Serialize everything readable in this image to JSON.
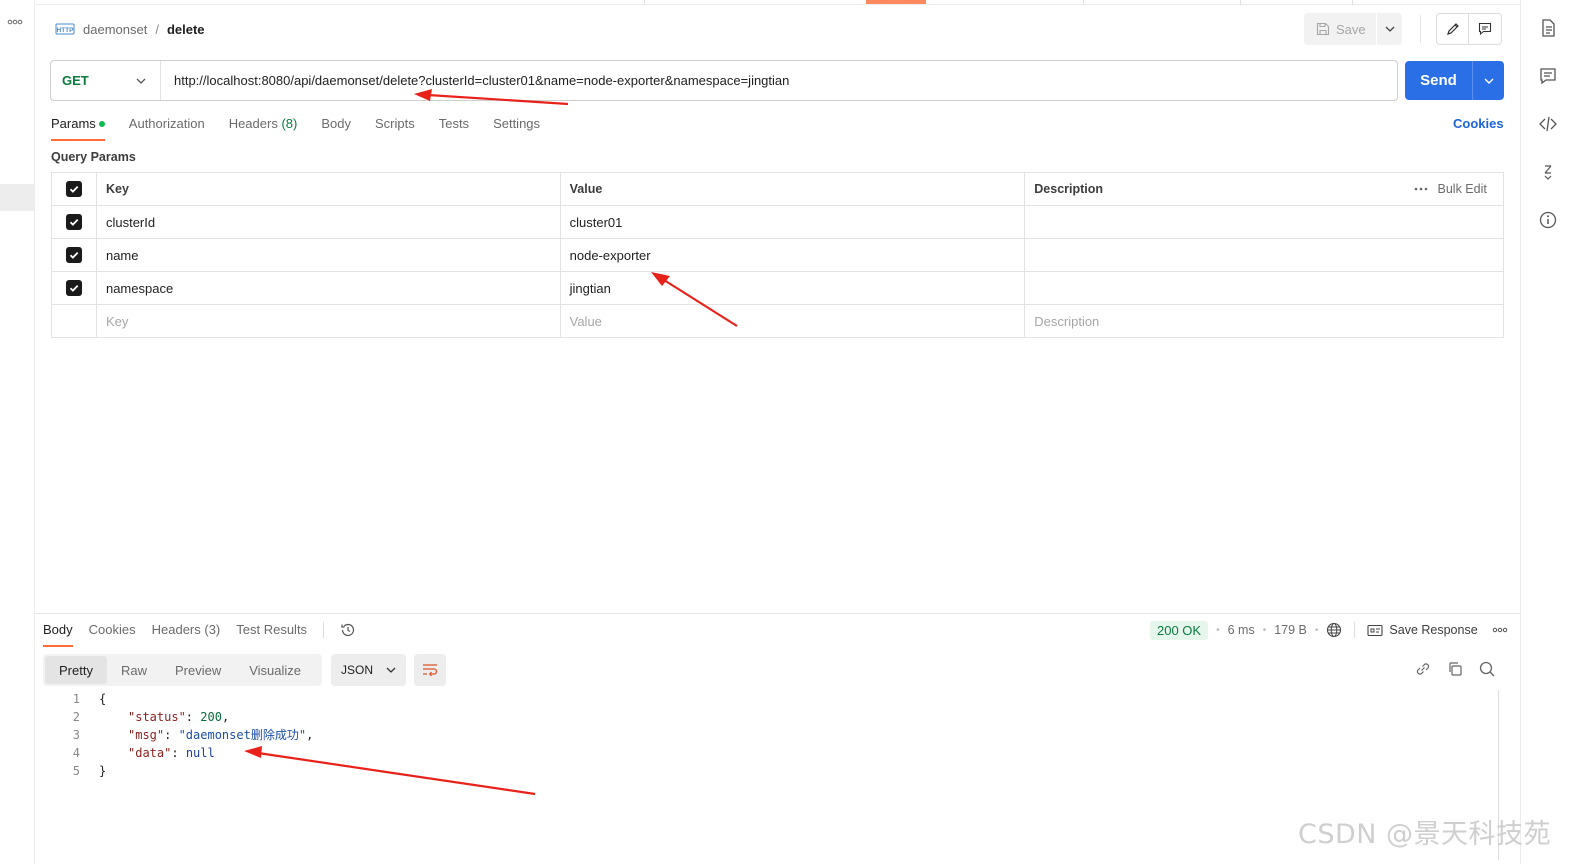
{
  "header": {
    "breadcrumb_parent": "daemonset",
    "breadcrumb_separator": "/",
    "breadcrumb_current": "delete",
    "save_label": "Save"
  },
  "request": {
    "method": "GET",
    "url": "http://localhost:8080/api/daemonset/delete?clusterId=cluster01&name=node-exporter&namespace=jingtian",
    "send_label": "Send"
  },
  "request_tabs": {
    "params": "Params",
    "authorization": "Authorization",
    "headers": "Headers",
    "headers_count": "(8)",
    "body": "Body",
    "scripts": "Scripts",
    "tests": "Tests",
    "settings": "Settings",
    "cookies": "Cookies"
  },
  "query_params": {
    "title": "Query Params",
    "columns": {
      "key": "Key",
      "value": "Value",
      "description": "Description",
      "bulk_edit": "Bulk Edit"
    },
    "rows": [
      {
        "key": "clusterId",
        "value": "cluster01",
        "description": ""
      },
      {
        "key": "name",
        "value": "node-exporter",
        "description": ""
      },
      {
        "key": "namespace",
        "value": "jingtian",
        "description": ""
      }
    ],
    "placeholders": {
      "key": "Key",
      "value": "Value",
      "description": "Description"
    }
  },
  "response": {
    "tabs": {
      "body": "Body",
      "cookies": "Cookies",
      "headers": "Headers (3)",
      "test_results": "Test Results"
    },
    "status": "200 OK",
    "time": "6 ms",
    "size": "179 B",
    "save_response": "Save Response",
    "views": {
      "pretty": "Pretty",
      "raw": "Raw",
      "preview": "Preview",
      "visualize": "Visualize"
    },
    "format": "JSON",
    "code": {
      "line_numbers": [
        "1",
        "2",
        "3",
        "4",
        "5"
      ],
      "open_brace": "{",
      "close_brace": "}",
      "status_key": "\"status\"",
      "status_value": "200",
      "msg_key": "\"msg\"",
      "msg_value": "\"daemonset删除成功\"",
      "data_key": "\"data\"",
      "data_value": "null"
    }
  },
  "watermark": "CSDN @景天科技苑",
  "colors": {
    "accent": "#ff6c37",
    "send": "#2b6fe6",
    "method_get": "#0b7b3e",
    "annotation_arrow": "#e8221b"
  }
}
